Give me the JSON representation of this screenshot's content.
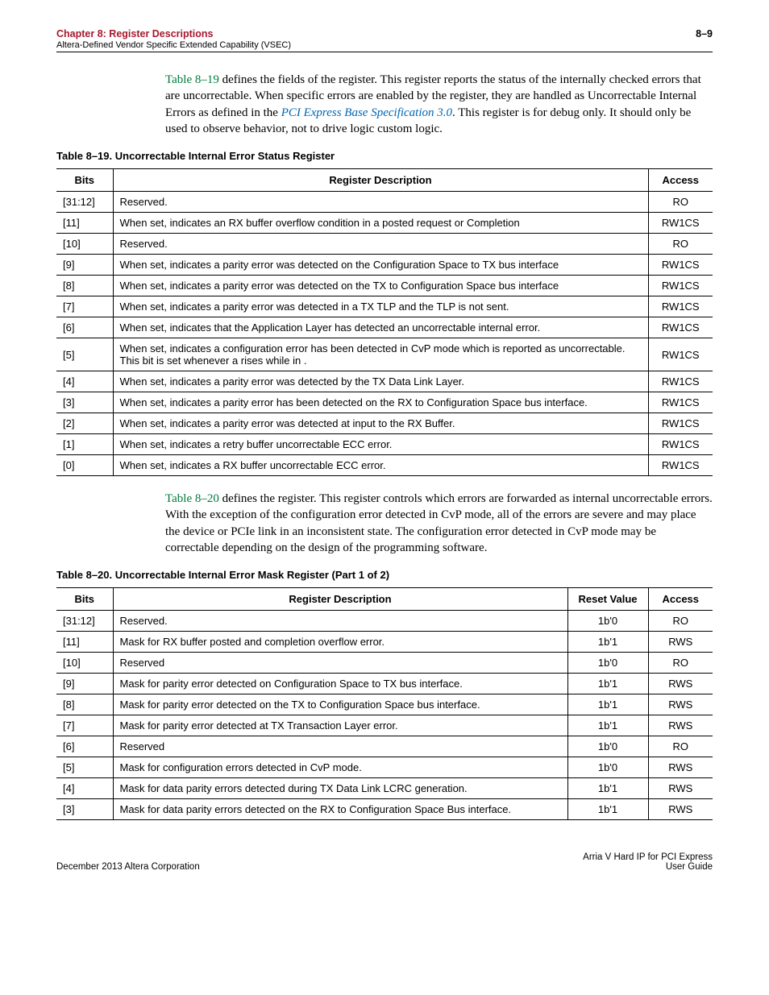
{
  "header": {
    "chapter": "Chapter 8: Register Descriptions",
    "subtitle": "Altera-Defined Vendor Specific Extended Capability (VSEC)",
    "pagenum": "8–9"
  },
  "para1": {
    "ref": "Table 8–19",
    "t1": " defines the fields of the ",
    "t2": " register. This register reports the status of the internally checked errors that are uncorrectable. When specific errors are enabled by the ",
    "t3": " register, they are handled as Uncorrectable Internal Errors as defined in the ",
    "spec": "PCI Express Base Specification 3.0",
    "t4": ". This register is for debug only. It should only be used to observe behavior, not to drive logic custom logic."
  },
  "table19": {
    "caption": "Table 8–19.  Uncorrectable Internal Error Status Register",
    "headers": {
      "bits": "Bits",
      "desc": "Register Description",
      "access": "Access"
    },
    "rows": [
      {
        "bits": "[31:12]",
        "desc": "Reserved.",
        "access": "RO"
      },
      {
        "bits": "[11]",
        "desc": "When set, indicates an RX buffer overflow condition in a posted request or Completion",
        "access": "RW1CS"
      },
      {
        "bits": "[10]",
        "desc": "Reserved.",
        "access": "RO"
      },
      {
        "bits": "[9]",
        "desc": "When set, indicates a parity error was detected on the Configuration Space to TX bus interface",
        "access": "RW1CS"
      },
      {
        "bits": "[8]",
        "desc": "When set, indicates a parity error was detected on the TX to Configuration Space bus interface",
        "access": "RW1CS"
      },
      {
        "bits": "[7]",
        "desc": "When set, indicates a parity error was detected in a TX TLP and the TLP is not sent.",
        "access": "RW1CS"
      },
      {
        "bits": "[6]",
        "desc": "When set, indicates that the Application Layer has detected an uncorrectable internal error.",
        "access": "RW1CS"
      },
      {
        "bits": "[5]",
        "desc": "When set, indicates a configuration error has been detected in CvP mode which is reported as uncorrectable. This bit is set whenever a                                     rises while in                                 .",
        "access": "RW1CS"
      },
      {
        "bits": "[4]",
        "desc": "When set, indicates a parity error was detected by the TX Data Link Layer.",
        "access": "RW1CS"
      },
      {
        "bits": "[3]",
        "desc": "When set, indicates a parity error has been detected on the RX to Configuration Space bus interface.",
        "access": "RW1CS"
      },
      {
        "bits": "[2]",
        "desc": "When set, indicates a parity error was detected at input to the RX Buffer.",
        "access": "RW1CS"
      },
      {
        "bits": "[1]",
        "desc": "When set, indicates a retry buffer uncorrectable ECC error.",
        "access": "RW1CS"
      },
      {
        "bits": "[0]",
        "desc": "When set, indicates a RX buffer uncorrectable ECC error.",
        "access": "RW1CS"
      }
    ]
  },
  "para2": {
    "ref": "Table 8–20",
    "t1": " defines the ",
    "t2": " register. This register controls which errors are forwarded as internal uncorrectable errors. With the exception of the configuration error detected in CvP mode, all of the errors are severe and may place the device or PCIe link in an inconsistent state. The configuration error detected in CvP mode may be correctable depending on the design of the programming software."
  },
  "table20": {
    "caption": "Table 8–20.  Uncorrectable Internal Error Mask Register   (Part 1 of 2)",
    "headers": {
      "bits": "Bits",
      "desc": "Register Description",
      "reset": "Reset Value",
      "access": "Access"
    },
    "rows": [
      {
        "bits": "[31:12]",
        "desc": "Reserved.",
        "reset": "1b'0",
        "access": "RO"
      },
      {
        "bits": "[11]",
        "desc": "Mask for RX buffer posted and completion overflow error.",
        "reset": "1b'1",
        "access": "RWS"
      },
      {
        "bits": "[10]",
        "desc": "Reserved",
        "reset": "1b'0",
        "access": "RO"
      },
      {
        "bits": "[9]",
        "desc": "Mask for parity error detected on Configuration Space to TX bus interface.",
        "reset": "1b'1",
        "access": "RWS"
      },
      {
        "bits": "[8]",
        "desc": "Mask for parity error detected on the TX to Configuration Space bus interface.",
        "reset": "1b'1",
        "access": "RWS"
      },
      {
        "bits": "[7]",
        "desc": "Mask for parity error detected at TX Transaction Layer error.",
        "reset": "1b'1",
        "access": "RWS"
      },
      {
        "bits": "[6]",
        "desc": "Reserved",
        "reset": "1b'0",
        "access": "RO"
      },
      {
        "bits": "[5]",
        "desc": "Mask for configuration errors detected in CvP mode.",
        "reset": "1b'0",
        "access": "RWS"
      },
      {
        "bits": "[4]",
        "desc": "Mask for data parity errors detected during TX Data Link LCRC generation.",
        "reset": "1b'1",
        "access": "RWS"
      },
      {
        "bits": "[3]",
        "desc": "Mask for data parity errors detected on the RX to Configuration Space Bus interface.",
        "reset": "1b'1",
        "access": "RWS"
      }
    ]
  },
  "footer": {
    "left": "December 2013   Altera Corporation",
    "right1": "Arria V Hard IP for PCI Express",
    "right2": "User Guide"
  }
}
